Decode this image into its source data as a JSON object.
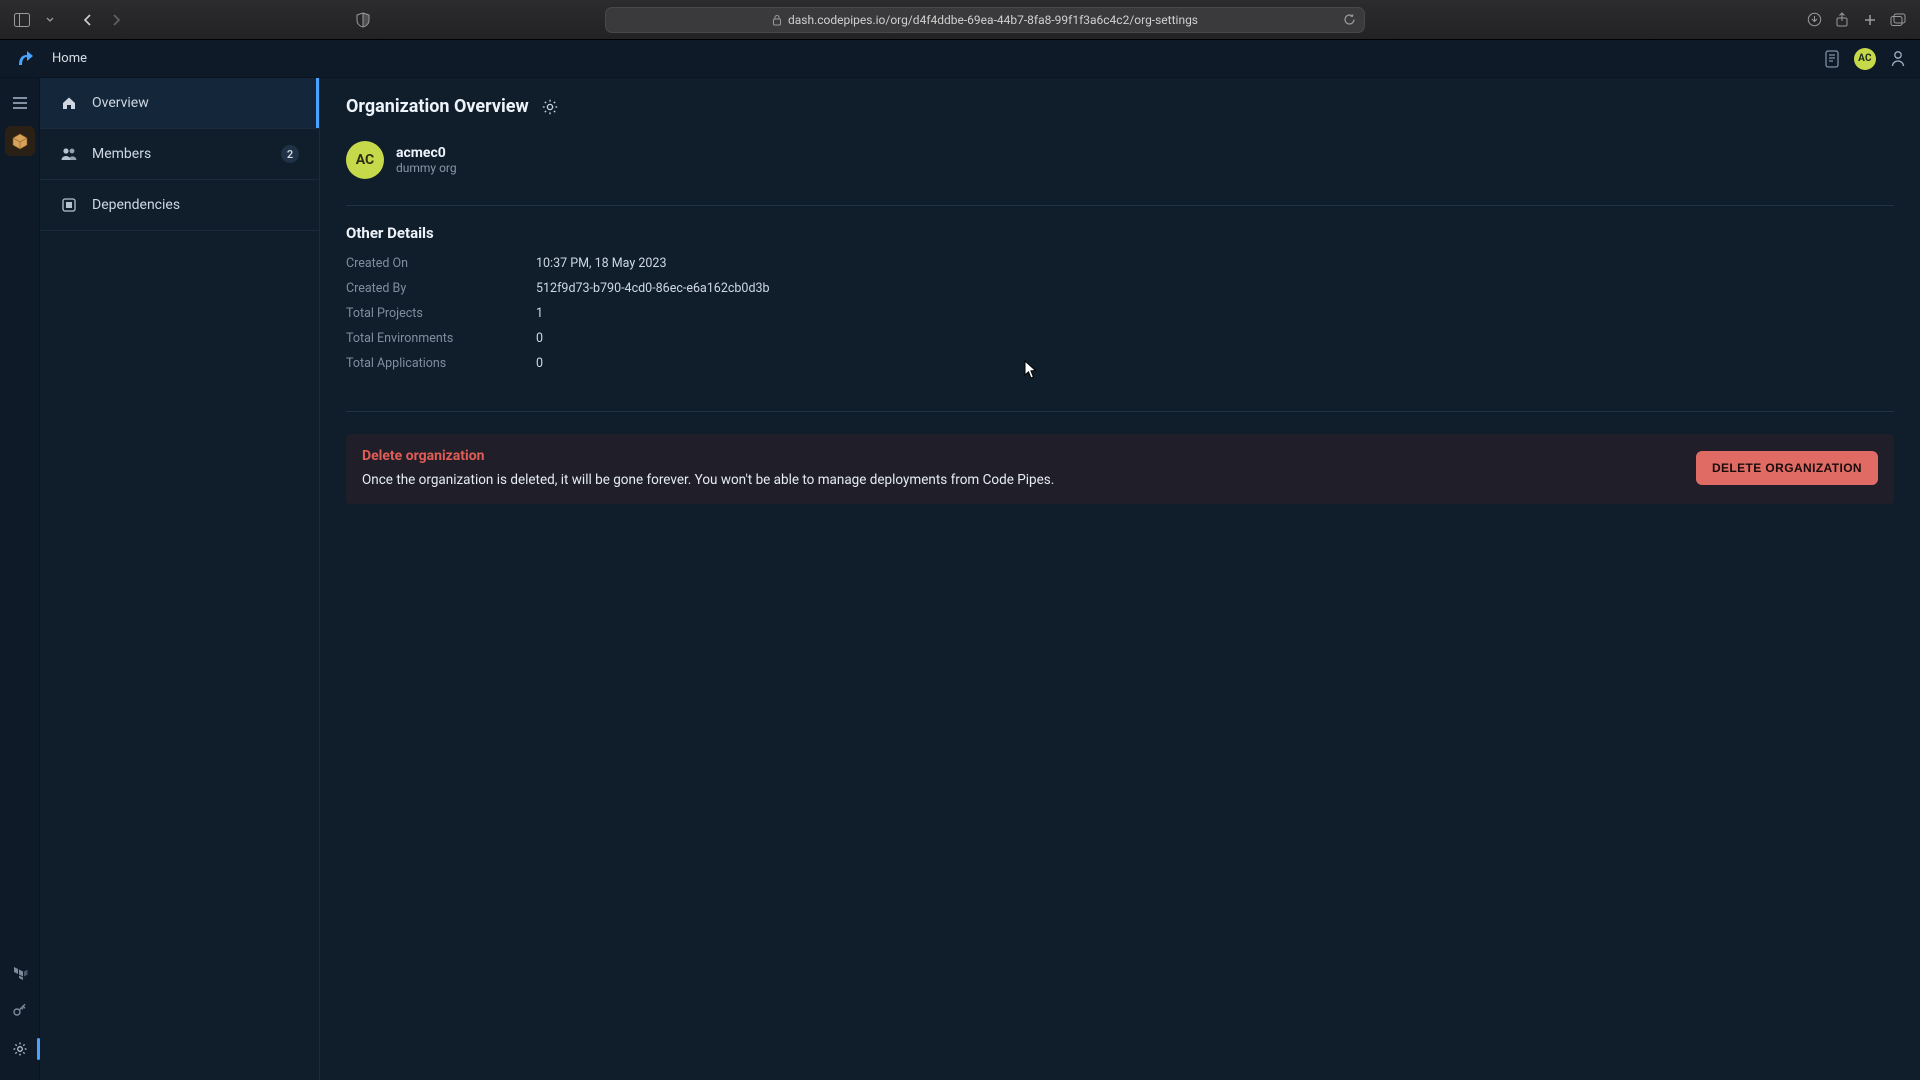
{
  "browser": {
    "url": "dash.codepipes.io/org/d4f4ddbe-69ea-44b7-8fa8-99f1f3a6c4c2/org-settings"
  },
  "header": {
    "home_label": "Home",
    "avatar_initials": "AC"
  },
  "sidebar": {
    "items": [
      {
        "label": "Overview"
      },
      {
        "label": "Members",
        "badge": "2"
      },
      {
        "label": "Dependencies"
      }
    ]
  },
  "page": {
    "title": "Organization Overview",
    "org": {
      "avatar_initials": "AC",
      "name": "acmec0",
      "subtitle": "dummy org"
    },
    "other_details_heading": "Other Details",
    "details": {
      "created_on_label": "Created On",
      "created_on_value": "10:37 PM, 18 May 2023",
      "created_by_label": "Created By",
      "created_by_value": "512f9d73-b790-4cd0-86ec-e6a162cb0d3b",
      "total_projects_label": "Total Projects",
      "total_projects_value": "1",
      "total_environments_label": "Total Environments",
      "total_environments_value": "0",
      "total_applications_label": "Total Applications",
      "total_applications_value": "0"
    },
    "danger": {
      "title": "Delete organization",
      "description": "Once the organization is deleted, it will be gone forever. You won't be able to manage deployments from Code Pipes.",
      "button_label": "DELETE ORGANIZATION"
    }
  }
}
